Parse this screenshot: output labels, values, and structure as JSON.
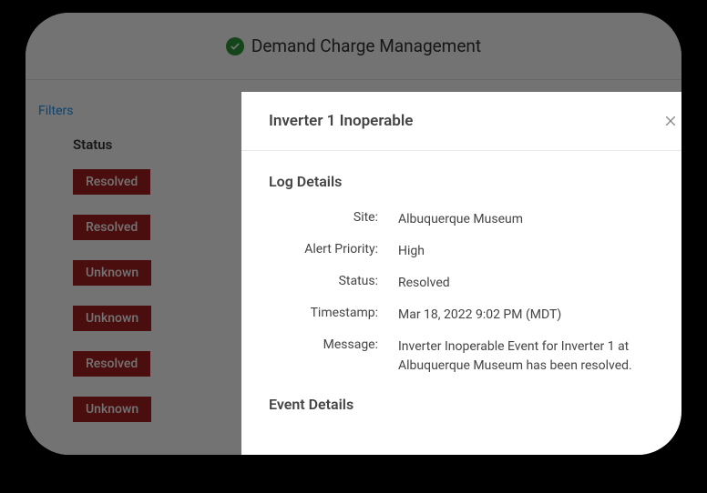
{
  "header": {
    "title": "Demand Charge Management"
  },
  "filters_label": "Filters",
  "status_column_label": "Status",
  "status_badges": [
    "Resolved",
    "Resolved",
    "Unknown",
    "Unknown",
    "Resolved",
    "Unknown"
  ],
  "modal": {
    "title": "Inverter 1 Inoperable",
    "log_details_heading": "Log Details",
    "event_details_heading": "Event Details",
    "fields": {
      "site": {
        "label": "Site:",
        "value": "Albuquerque Museum"
      },
      "priority": {
        "label": "Alert Priority:",
        "value": "High"
      },
      "status": {
        "label": "Status:",
        "value": "Resolved"
      },
      "timestamp": {
        "label": "Timestamp:",
        "value": "Mar 18, 2022 9:02 PM (MDT)"
      },
      "message": {
        "label": "Message:",
        "value": "Inverter Inoperable Event for Inverter 1 at Albuquerque Museum has been resolved."
      }
    }
  }
}
